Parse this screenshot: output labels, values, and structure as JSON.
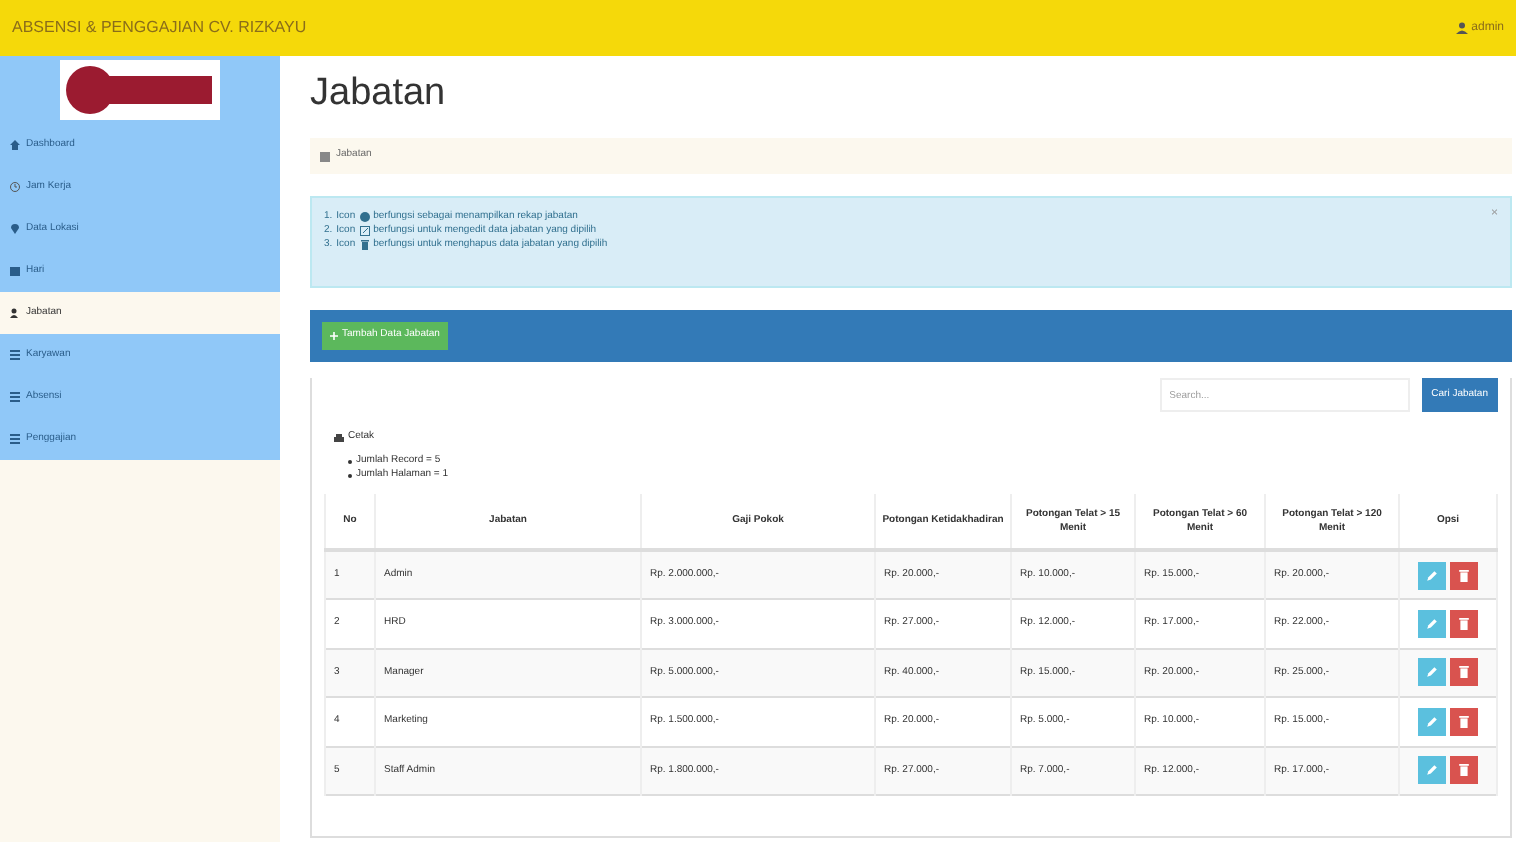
{
  "header": {
    "title": "ABSENSI & PENGGAJIAN CV. RIZKAYU",
    "user": "admin"
  },
  "sidebar": {
    "items": [
      {
        "label": "Dashboard",
        "kind": "home",
        "selected": false
      },
      {
        "label": "Jam Kerja",
        "kind": "clock",
        "selected": false
      },
      {
        "label": "Data Lokasi",
        "kind": "pin",
        "selected": false
      },
      {
        "label": "Hari",
        "kind": "calendar",
        "selected": false
      },
      {
        "label": "Jabatan",
        "kind": "users",
        "selected": true
      },
      {
        "label": "Karyawan",
        "kind": "list",
        "selected": false
      },
      {
        "label": "Absensi",
        "kind": "list",
        "selected": false
      },
      {
        "label": "Penggajian",
        "kind": "list",
        "selected": false
      }
    ]
  },
  "page_title": "Jabatan",
  "breadcrumb": "Jabatan",
  "info": [
    {
      "number": "1.",
      "before": "Icon",
      "kind": "eye",
      "after": "berfungsi sebagai menampilkan rekap jabatan"
    },
    {
      "number": "2.",
      "before": "Icon",
      "kind": "edit",
      "after": "berfungsi untuk mengedit data jabatan yang dipilih"
    },
    {
      "number": "3.",
      "before": "Icon",
      "kind": "trash",
      "after": "berfungsi untuk menghapus data jabatan yang dipilih"
    }
  ],
  "info_close": "×",
  "add_button": "Tambah Data Jabatan",
  "search": {
    "placeholder": "Search...",
    "button": "Cari Jabatan"
  },
  "print_button": "Cetak",
  "summary": [
    "Jumlah Record = 5",
    "Jumlah Halaman = 1"
  ],
  "table": {
    "columns": [
      "No",
      "Jabatan",
      "Gaji Pokok",
      "Potongan Ketidakhadiran",
      "Potongan Telat > 15 Menit",
      "Potongan Telat > 60 Menit",
      "Potongan Telat > 120 Menit",
      "Opsi"
    ],
    "rows": [
      [
        "1",
        "Admin",
        "Rp. 2.000.000,-",
        "Rp. 20.000,-",
        "Rp. 10.000,-",
        "Rp. 15.000,-",
        "Rp. 20.000,-"
      ],
      [
        "2",
        "HRD",
        "Rp. 3.000.000,-",
        "Rp. 27.000,-",
        "Rp. 12.000,-",
        "Rp. 17.000,-",
        "Rp. 22.000,-"
      ],
      [
        "3",
        "Manager",
        "Rp. 5.000.000,-",
        "Rp. 40.000,-",
        "Rp. 15.000,-",
        "Rp. 20.000,-",
        "Rp. 25.000,-"
      ],
      [
        "4",
        "Marketing",
        "Rp. 1.500.000,-",
        "Rp. 20.000,-",
        "Rp. 5.000,-",
        "Rp. 10.000,-",
        "Rp. 15.000,-"
      ],
      [
        "5",
        "Staff Admin",
        "Rp. 1.800.000,-",
        "Rp. 27.000,-",
        "Rp. 7.000,-",
        "Rp. 12.000,-",
        "Rp. 17.000,-"
      ]
    ]
  }
}
